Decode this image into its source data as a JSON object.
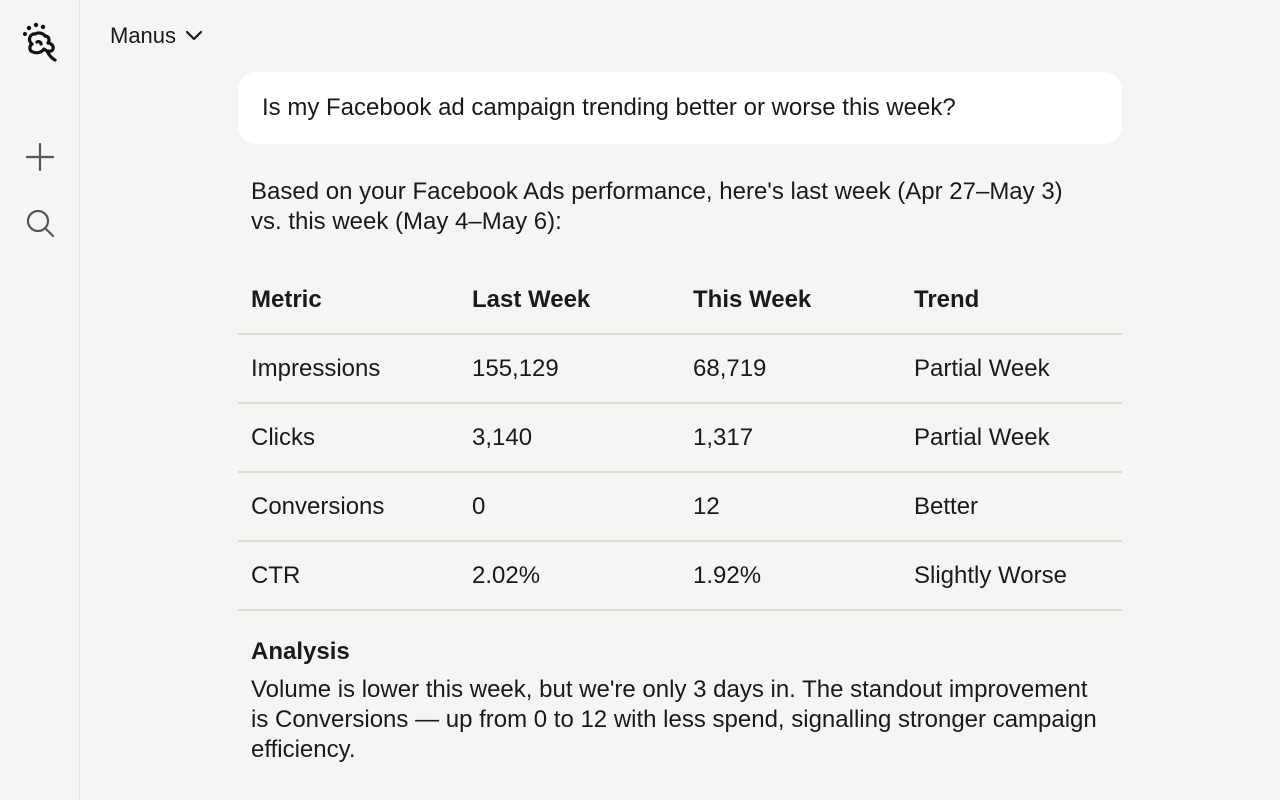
{
  "header": {
    "model_name": "Manus"
  },
  "sidebar": {
    "icons": [
      "manus-logo-icon",
      "plus-icon",
      "search-icon"
    ]
  },
  "conversation": {
    "user_message": "Is my Facebook ad campaign trending better or worse this week?",
    "assistant": {
      "intro": "Based on your Facebook Ads performance, here's last week (Apr 27–May 3) vs. this week (May 4–May 6):",
      "table": {
        "headers": [
          "Metric",
          "Last Week",
          "This Week",
          "Trend"
        ],
        "rows": [
          [
            "Impressions",
            "155,129",
            "68,719",
            "Partial Week"
          ],
          [
            "Clicks",
            "3,140",
            "1,317",
            "Partial Week"
          ],
          [
            "Conversions",
            "0",
            "12",
            "Better"
          ],
          [
            "CTR",
            "2.02%",
            "1.92%",
            "Slightly Worse"
          ]
        ]
      },
      "analysis_title": "Analysis",
      "analysis_body": "Volume is lower this week, but we're only 3 days in. The standout improvement is Conversions — up from 0 to 12 with less spend, signalling stronger campaign efficiency."
    }
  }
}
